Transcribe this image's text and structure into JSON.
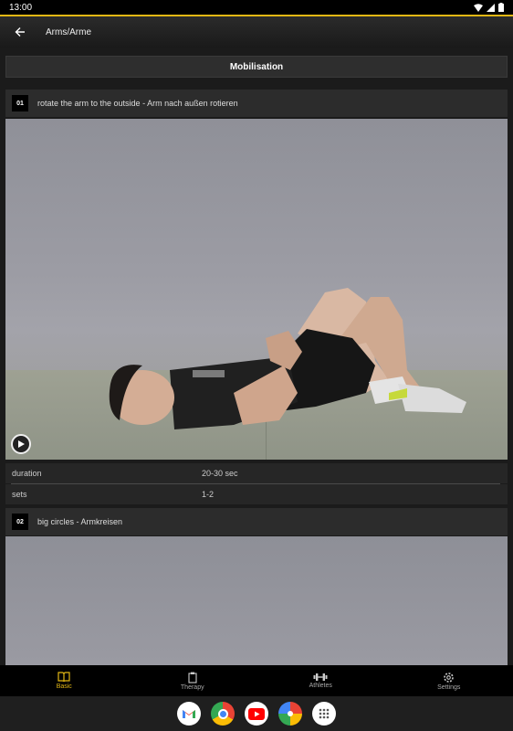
{
  "status_bar": {
    "time": "13:00"
  },
  "app_bar": {
    "title": "Arms/Arme"
  },
  "section": {
    "title": "Mobilisation"
  },
  "exercises": [
    {
      "number": "01",
      "title": "rotate the arm to the outside - Arm nach außen rotieren",
      "details": [
        {
          "label": "duration",
          "value": "20-30 sec"
        },
        {
          "label": "sets",
          "value": "1-2"
        }
      ]
    },
    {
      "number": "02",
      "title": "big circles - Armkreisen"
    }
  ],
  "bottom_nav": {
    "items": [
      {
        "label": "Basic",
        "icon": "book-icon",
        "active": true
      },
      {
        "label": "Therapy",
        "icon": "clipboard-icon",
        "active": false
      },
      {
        "label": "Athletes",
        "icon": "dumbbell-icon",
        "active": false
      },
      {
        "label": "Settings",
        "icon": "gear-icon",
        "active": false
      }
    ]
  },
  "taskbar": {
    "apps": [
      "gmail-icon",
      "chrome-icon",
      "youtube-icon",
      "photos-icon",
      "app-drawer-icon"
    ]
  },
  "colors": {
    "accent": "#e2b714",
    "background": "#1b1b1b",
    "card": "#2c2c2c"
  }
}
